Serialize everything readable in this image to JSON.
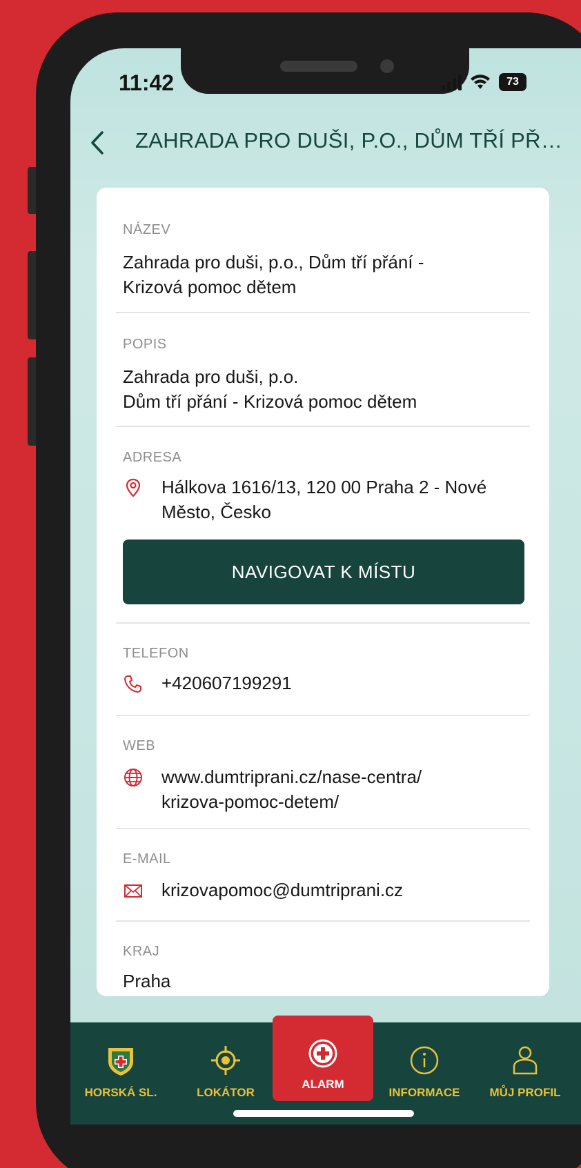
{
  "status_bar": {
    "time": "11:42",
    "battery": "73"
  },
  "header": {
    "title": "ZAHRADA PRO DUŠI, P.O., DŮM TŘÍ PŘÁ..."
  },
  "detail": {
    "name": {
      "label": "NÁZEV",
      "line1": "Zahrada pro duši, p.o., Dům tří přání -",
      "line2": "Krizová pomoc dětem"
    },
    "description": {
      "label": "POPIS",
      "line1": "Zahrada pro duši, p.o.",
      "line2": "Dům tří přání - Krizová pomoc dětem"
    },
    "address": {
      "label": "ADRESA",
      "line1": "Hálkova 1616/13, 120 00 Praha 2 - Nové",
      "line2": "Město, Česko"
    },
    "navigate_button": "NAVIGOVAT K MÍSTU",
    "phone": {
      "label": "TELEFON",
      "value": "+420607199291"
    },
    "web": {
      "label": "WEB",
      "line1": "www.dumtriprani.cz/nase-centra/",
      "line2": "krizova-pomoc-detem/"
    },
    "email": {
      "label": "E-MAIL",
      "value": "krizovapomoc@dumtriprani.cz"
    },
    "region": {
      "label": "KRAJ",
      "value": "Praha"
    }
  },
  "tabbar": {
    "tabs": [
      {
        "label": "HORSKÁ SL.",
        "icon": "mountain-rescue-badge-icon"
      },
      {
        "label": "LOKÁTOR",
        "icon": "locator-crosshair-icon"
      },
      {
        "label": "ALARM",
        "icon": "plus-circle-icon"
      },
      {
        "label": "INFORMACE",
        "icon": "info-icon"
      },
      {
        "label": "MŮJ PROFIL",
        "icon": "profile-icon"
      }
    ]
  },
  "colors": {
    "accent_dark_green": "#17443c",
    "alarm_red": "#d42a32",
    "tab_label_gold": "#e7c23a",
    "background_red": "#d42a32"
  }
}
